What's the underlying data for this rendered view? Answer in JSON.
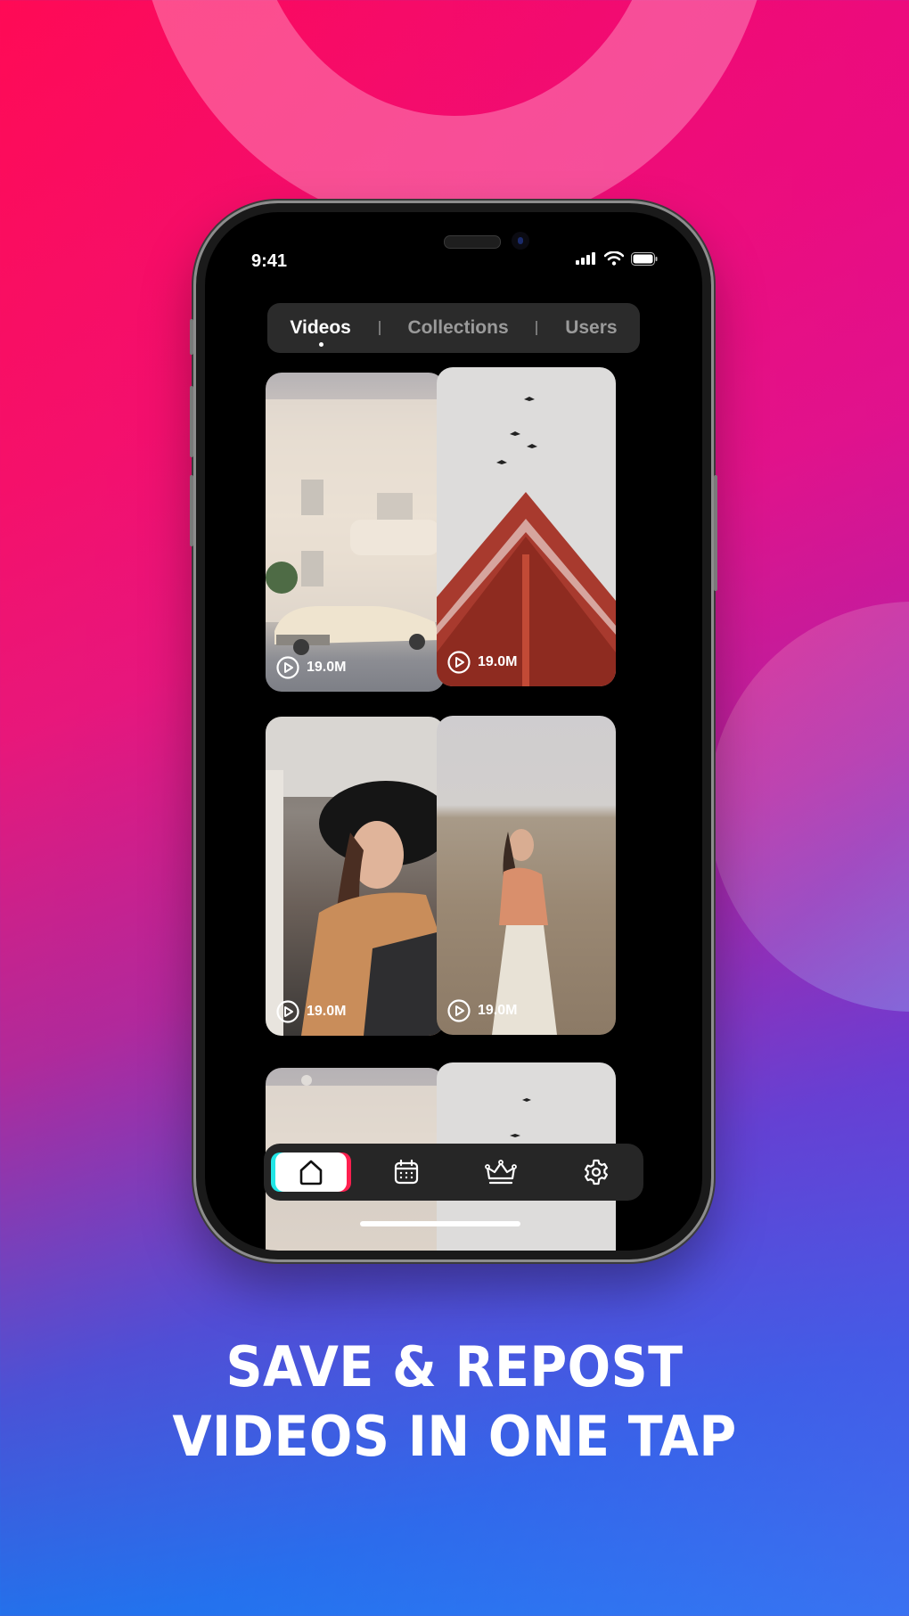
{
  "status_bar": {
    "time": "9:41",
    "icons": [
      "cellular-signal-icon",
      "wifi-icon",
      "battery-icon"
    ]
  },
  "segmented_control": {
    "tabs": [
      {
        "label": "Videos",
        "active": true
      },
      {
        "label": "Collections",
        "active": false
      },
      {
        "label": "Users",
        "active": false
      }
    ]
  },
  "video_grid": {
    "items": [
      {
        "scene": "cream art-deco building with vintage car",
        "views": "19.0M"
      },
      {
        "scene": "red pagoda roof with birds",
        "views": "19.0M"
      },
      {
        "scene": "woman in black hat seated",
        "views": "19.0M"
      },
      {
        "scene": "woman in wheat field",
        "views": "19.0M"
      },
      {
        "scene": "cream art-deco building with vintage car",
        "views": ""
      },
      {
        "scene": "red pagoda roof with birds",
        "views": ""
      }
    ]
  },
  "tab_bar": {
    "items": [
      {
        "icon": "home-icon",
        "active": true
      },
      {
        "icon": "calendar-icon",
        "active": false
      },
      {
        "icon": "crown-icon",
        "active": false
      },
      {
        "icon": "gear-icon",
        "active": false
      }
    ]
  },
  "headline": {
    "line1": "SAVE & REPOST",
    "line2": "VIDEOS IN ONE TAP"
  },
  "colors": {
    "accent_cyan": "#22e6e6",
    "accent_red": "#ff1f4f",
    "background_top": "#ff0a55",
    "background_bottom": "#0a98ff"
  }
}
